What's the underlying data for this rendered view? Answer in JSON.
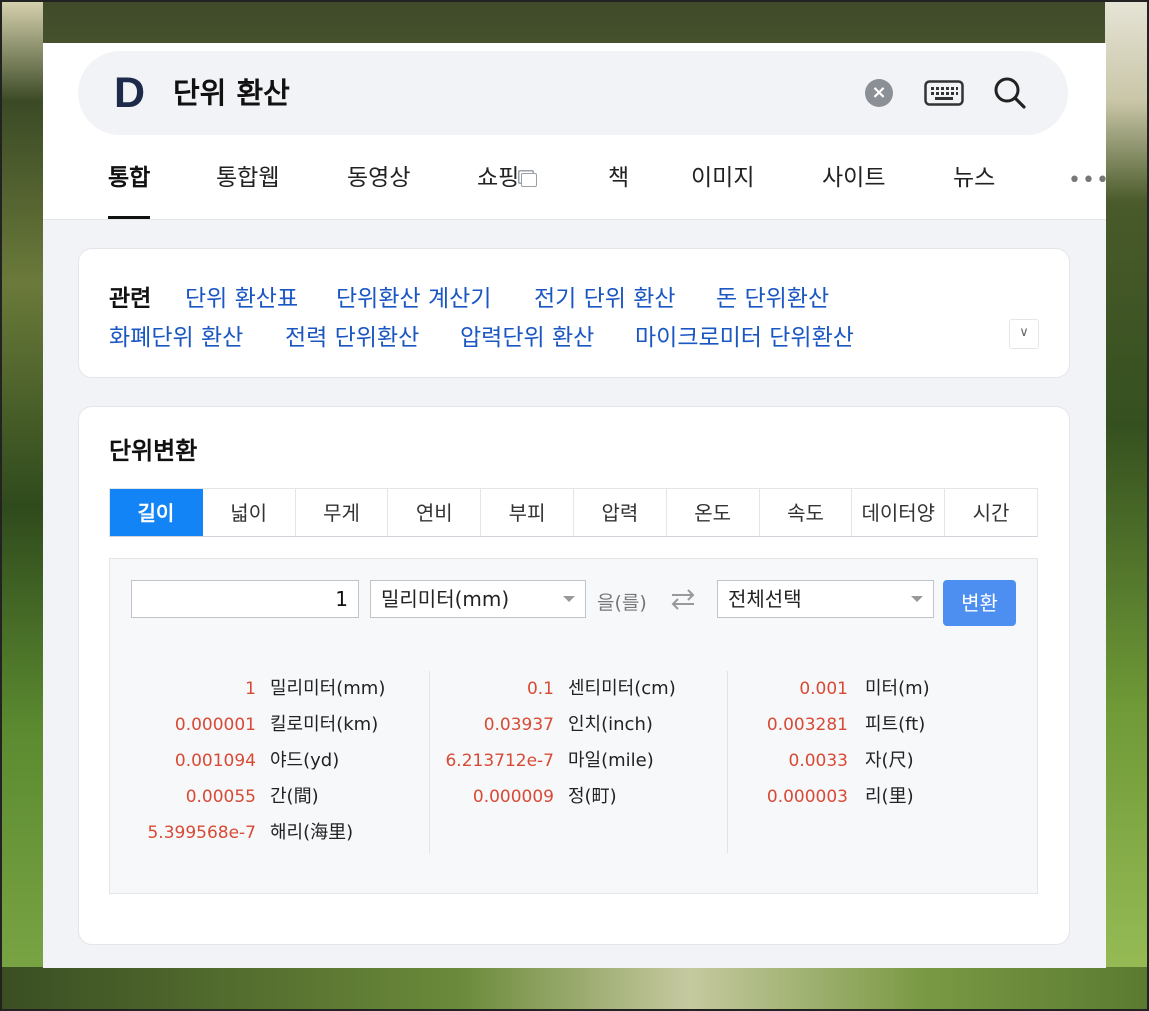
{
  "search": {
    "logo": "D",
    "query": "단위 환산"
  },
  "tabs": [
    {
      "label": "통합",
      "active": true
    },
    {
      "label": "통합웹"
    },
    {
      "label": "동영상"
    },
    {
      "label": "쇼핑"
    },
    {
      "label": "책"
    },
    {
      "label": "이미지"
    },
    {
      "label": "사이트"
    },
    {
      "label": "뉴스"
    }
  ],
  "related": {
    "title": "관련",
    "links": [
      "단위 환산표",
      "단위환산 계산기",
      "전기 단위 환산",
      "돈 단위환산",
      "화폐단위 환산",
      "전력 단위환산",
      "압력단위 환산",
      "마이크로미터 단위환산"
    ]
  },
  "converter": {
    "title": "단위변환",
    "categories": [
      "길이",
      "넓이",
      "무게",
      "연비",
      "부피",
      "압력",
      "온도",
      "속도",
      "데이터양",
      "시간"
    ],
    "active_category": "길이",
    "input_value": "1",
    "from_unit": "밀리미터(mm)",
    "particle": "을(를)",
    "to_unit": "전체선택",
    "convert_label": "변환",
    "results": [
      [
        {
          "value": "1",
          "unit": "밀리미터(mm)"
        },
        {
          "value": "0.000001",
          "unit": "킬로미터(km)"
        },
        {
          "value": "0.001094",
          "unit": "야드(yd)"
        },
        {
          "value": "0.00055",
          "unit": "간(間)"
        },
        {
          "value": "5.399568e-7",
          "unit": "해리(海里)"
        }
      ],
      [
        {
          "value": "0.1",
          "unit": "센티미터(cm)"
        },
        {
          "value": "0.03937",
          "unit": "인치(inch)"
        },
        {
          "value": "6.213712e-7",
          "unit": "마일(mile)"
        },
        {
          "value": "0.000009",
          "unit": "정(町)"
        }
      ],
      [
        {
          "value": "0.001",
          "unit": "미터(m)"
        },
        {
          "value": "0.003281",
          "unit": "피트(ft)"
        },
        {
          "value": "0.0033",
          "unit": "자(尺)"
        },
        {
          "value": "0.000003",
          "unit": "리(里)"
        }
      ]
    ]
  }
}
